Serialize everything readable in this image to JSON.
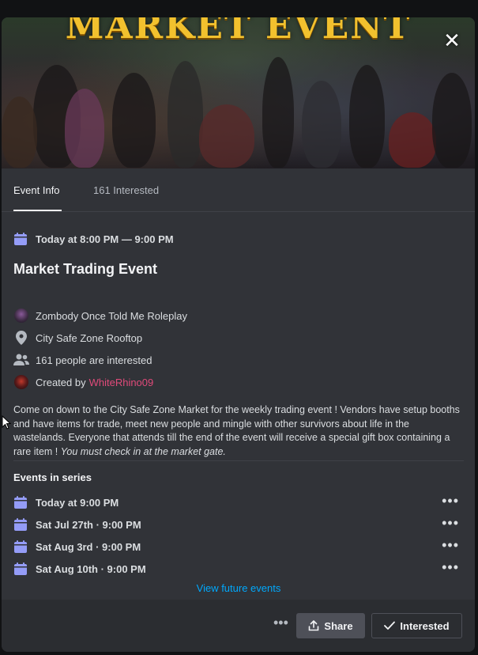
{
  "banner": {
    "title": "MARKET EVENT",
    "close_icon": "close-icon"
  },
  "tabs": [
    {
      "label": "Event Info",
      "active": true
    },
    {
      "label": "161 Interested",
      "active": false
    }
  ],
  "event": {
    "time": "Today at 8:00 PM — 9:00 PM",
    "title": "Market Trading Event",
    "server": "Zombody Once Told Me Roleplay",
    "location": "City Safe Zone Rooftop",
    "interested": "161 people are interested",
    "created_by_label": "Created by",
    "creator": "WhiteRhino09",
    "description": "Come on down to the City Safe Zone Market for the weekly trading event ! Vendors have setup booths and have items for trade, meet new people and mingle with other survivors about life in the wastelands. Everyone that attends till the end of the event will receive a special gift box containing a rare item ! ",
    "description_italic": "You must check in at the market gate."
  },
  "series": {
    "heading": "Events in series",
    "items": [
      {
        "label": "Today at 9:00 PM"
      },
      {
        "label": "Sat Jul 27th · 9:00 PM"
      },
      {
        "label": "Sat Aug 3rd · 9:00 PM"
      },
      {
        "label": "Sat Aug 10th · 9:00 PM"
      }
    ],
    "more_icon": "more-horizontal-icon",
    "view_future": "View future events"
  },
  "footer": {
    "more_icon": "more-horizontal-icon",
    "share_label": "Share",
    "interested_label": "Interested"
  },
  "colors": {
    "accent": "#949cf7",
    "link": "#00a8fc",
    "creator": "#e04a7a",
    "banner_title": "#f2c12e"
  }
}
